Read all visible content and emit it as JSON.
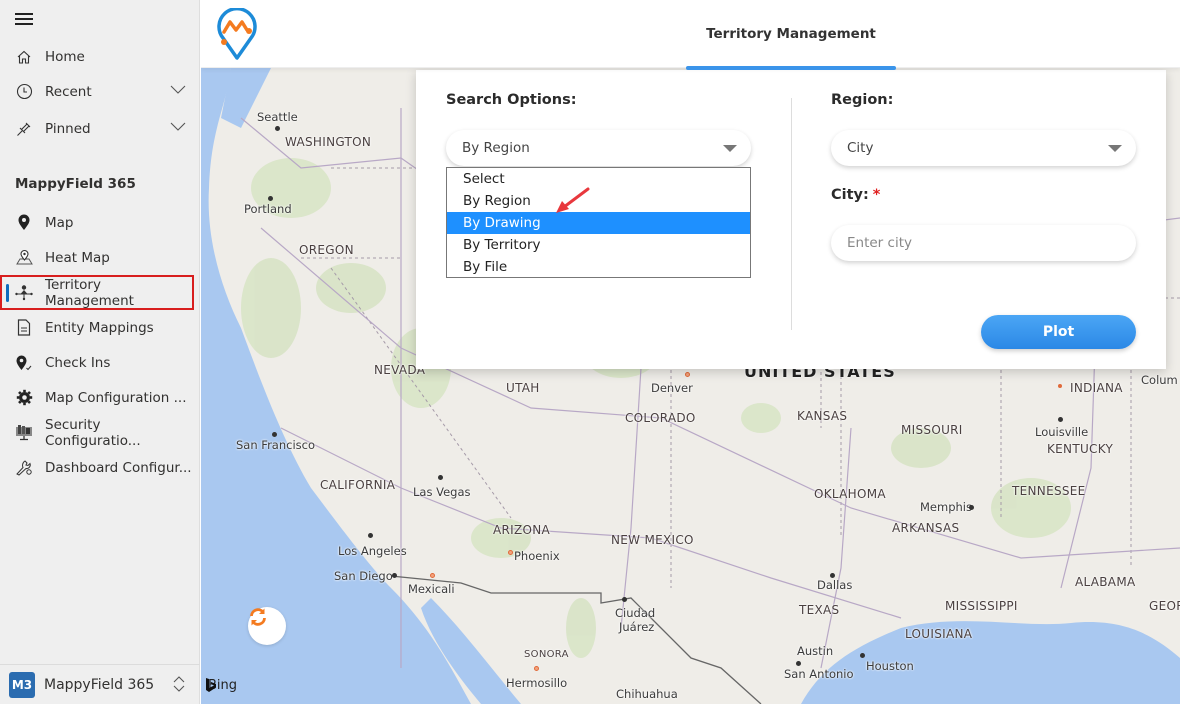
{
  "sidebar": {
    "menu_icon": "hamburger-icon",
    "top_items": [
      {
        "label": "Home",
        "icon": "home-icon"
      },
      {
        "label": "Recent",
        "icon": "clock-icon",
        "expandable": true
      },
      {
        "label": "Pinned",
        "icon": "pin-icon",
        "expandable": true
      }
    ],
    "section_title": "MappyField 365",
    "items": [
      {
        "label": "Map",
        "icon": "map-pin-icon"
      },
      {
        "label": "Heat Map",
        "icon": "heat-map-icon"
      },
      {
        "label": "Territory Management",
        "icon": "territory-icon",
        "active": true
      },
      {
        "label": "Entity Mappings",
        "icon": "document-icon"
      },
      {
        "label": "Check Ins",
        "icon": "check-in-icon"
      },
      {
        "label": "Map Configuration ...",
        "icon": "gear-icon"
      },
      {
        "label": "Security Configuratio...",
        "icon": "security-icon"
      },
      {
        "label": "Dashboard Configur...",
        "icon": "wrench-gear-icon"
      }
    ],
    "footer": {
      "badge": "M3",
      "app_name": "MappyField 365"
    }
  },
  "header": {
    "title": "Territory Management",
    "accent": "#3a94ea"
  },
  "panel": {
    "search_options_label": "Search Options:",
    "search_options_value": "By Region",
    "search_options_list": [
      "Select",
      "By Region",
      "By Drawing",
      "By Territory",
      "By File"
    ],
    "highlighted_option": "By Drawing",
    "region_label": "Region:",
    "region_value": "City",
    "city_label": "City:",
    "required_mark": "*",
    "city_placeholder": "Enter city",
    "plot_label": "Plot"
  },
  "map": {
    "attribution": "Bing",
    "country_label": "UNITED STATES",
    "states": [
      "WASHINGTON",
      "OREGON",
      "NEVADA",
      "UTAH",
      "CALIFORNIA",
      "ARIZONA",
      "NEW MEXICO",
      "COLORADO",
      "KANSAS",
      "OKLAHOMA",
      "TEXAS",
      "MISSOURI",
      "ARKANSAS",
      "LOUISIANA",
      "MISSISSIPPI",
      "ALABAMA",
      "TENNESSEE",
      "KENTUCKY",
      "INDIANA",
      "GEORGI",
      "SONORA"
    ],
    "cities": [
      "Seattle",
      "Portland",
      "San Francisco",
      "Las Vegas",
      "Los Angeles",
      "San Diego",
      "Mexicali",
      "Phoenix",
      "Denver",
      "Ciudad",
      "Juárez",
      "Hermosillo",
      "Chihuahua",
      "Dallas",
      "Austin",
      "San Antonio",
      "Houston",
      "Memphis",
      "Louisville",
      "Colum"
    ]
  }
}
